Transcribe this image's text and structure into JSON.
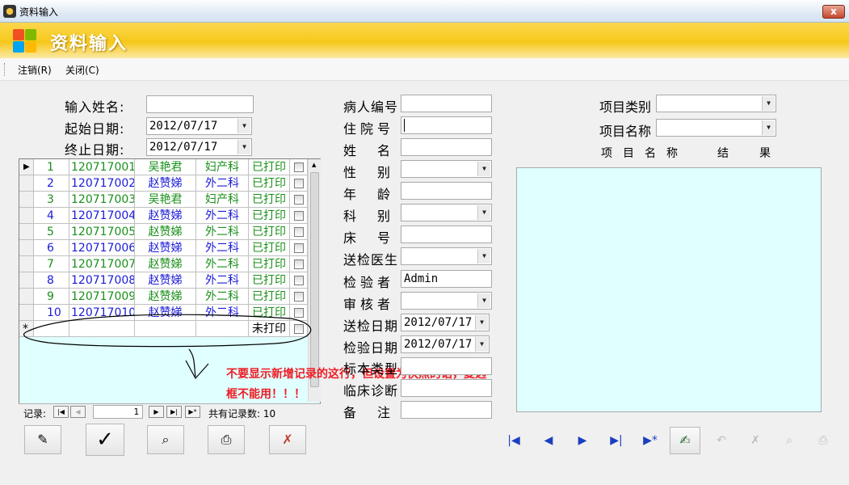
{
  "window": {
    "title": "资料输入",
    "close_label": "x"
  },
  "banner": {
    "title": "资料输入"
  },
  "menu": {
    "items": [
      "注销(R)",
      "关闭(C)"
    ]
  },
  "filters": {
    "input_name_label": "输入姓名:",
    "start_date_label": "起始日期:",
    "start_date": "2012/07/17",
    "end_date_label": "终止日期:",
    "end_date": "2012/07/17"
  },
  "grid": {
    "rows": [
      {
        "no": "1",
        "id": "120717001",
        "name": "吴艳君",
        "dept": "妇产科",
        "status": "已打印",
        "color": "green"
      },
      {
        "no": "2",
        "id": "120717002",
        "name": "赵赞娣",
        "dept": "外二科",
        "status": "已打印",
        "color": "blue"
      },
      {
        "no": "3",
        "id": "120717003",
        "name": "吴艳君",
        "dept": "妇产科",
        "status": "已打印",
        "color": "green"
      },
      {
        "no": "4",
        "id": "120717004",
        "name": "赵赞娣",
        "dept": "外二科",
        "status": "已打印",
        "color": "blue"
      },
      {
        "no": "5",
        "id": "120717005",
        "name": "赵赞娣",
        "dept": "外二科",
        "status": "已打印",
        "color": "green"
      },
      {
        "no": "6",
        "id": "120717006",
        "name": "赵赞娣",
        "dept": "外二科",
        "status": "已打印",
        "color": "blue"
      },
      {
        "no": "7",
        "id": "120717007",
        "name": "赵赞娣",
        "dept": "外二科",
        "status": "已打印",
        "color": "green"
      },
      {
        "no": "8",
        "id": "120717008",
        "name": "赵赞娣",
        "dept": "外二科",
        "status": "已打印",
        "color": "blue"
      },
      {
        "no": "9",
        "id": "120717009",
        "name": "赵赞娣",
        "dept": "外二科",
        "status": "已打印",
        "color": "green"
      },
      {
        "no": "10",
        "id": "120717010",
        "name": "赵赞娣",
        "dept": "外二科",
        "status": "已打印",
        "color": "blue"
      }
    ],
    "new_row_marker": "*",
    "new_row_status": "未打印"
  },
  "record_nav": {
    "label": "记录:",
    "current": "1",
    "total_label": "共有记录数: 10"
  },
  "patient": {
    "patient_no_label": "病人编号",
    "inpatient_no_label": "住院号",
    "name_label": "姓名",
    "gender_label": "性别",
    "age_label": "年龄",
    "dept_label": "科别",
    "bed_label": "床号",
    "doctor_label": "送检医生",
    "tester_label": "检验者",
    "tester_value": "Admin",
    "reviewer_label": "审核者",
    "send_date_label": "送检日期",
    "send_date": "2012/07/17",
    "test_date_label": "检验日期",
    "test_date": "2012/07/17",
    "sample_type_label": "标本类型",
    "diagnosis_label": "临床诊断",
    "remark_label": "备注"
  },
  "project": {
    "category_label": "项目类别",
    "name_label": "项目名称",
    "col_name_header": "项目名称",
    "col_result_header": "结果"
  },
  "annotation": {
    "line1": "不要显示新增记录的这行，但设置为快照的话，复选",
    "line2": "框不能用！！！"
  }
}
